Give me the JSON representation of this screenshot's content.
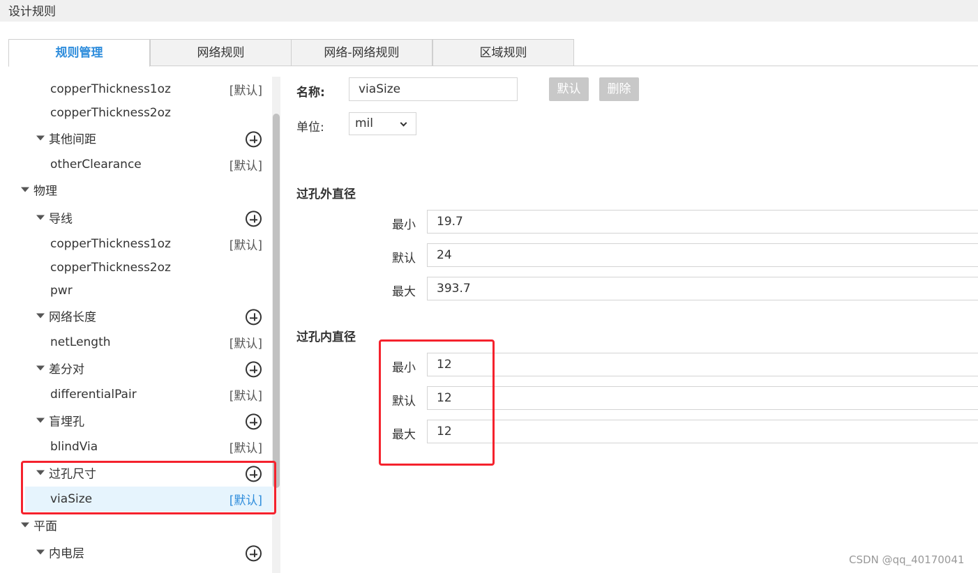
{
  "window": {
    "title": "设计规则"
  },
  "tabs": [
    {
      "label": "规则管理",
      "active": true
    },
    {
      "label": "网络规则",
      "active": false
    },
    {
      "label": "网络-网络规则",
      "active": false
    },
    {
      "label": "区域规则",
      "active": false
    }
  ],
  "tree": {
    "rows": [
      {
        "label": "copperThickness1oz",
        "tag": "[默认]"
      },
      {
        "label": "copperThickness2oz",
        "tag": ""
      },
      {
        "label": "其他间距",
        "tag": ""
      },
      {
        "label": "otherClearance",
        "tag": "[默认]"
      },
      {
        "label": "物理",
        "tag": ""
      },
      {
        "label": "导线",
        "tag": ""
      },
      {
        "label": "copperThickness1oz",
        "tag": "[默认]"
      },
      {
        "label": "copperThickness2oz",
        "tag": ""
      },
      {
        "label": "pwr",
        "tag": ""
      },
      {
        "label": "网络长度",
        "tag": ""
      },
      {
        "label": "netLength",
        "tag": "[默认]"
      },
      {
        "label": "差分对",
        "tag": ""
      },
      {
        "label": "differentialPair",
        "tag": "[默认]"
      },
      {
        "label": "盲埋孔",
        "tag": ""
      },
      {
        "label": "blindVia",
        "tag": "[默认]"
      },
      {
        "label": "过孔尺寸",
        "tag": ""
      },
      {
        "label": "viaSize",
        "tag": "[默认]"
      },
      {
        "label": "平面",
        "tag": ""
      },
      {
        "label": "内电层",
        "tag": ""
      }
    ]
  },
  "form": {
    "name_label": "名称:",
    "name_value": "viaSize",
    "default_button": "默认",
    "delete_button": "删除",
    "unit_label": "单位:",
    "unit_value": "mil",
    "outer": {
      "title": "过孔外直径",
      "min_label": "最小",
      "min_value": "19.7",
      "default_label": "默认",
      "default_value": "24",
      "max_label": "最大",
      "max_value": "393.7"
    },
    "inner": {
      "title": "过孔内直径",
      "min_label": "最小",
      "min_value": "12",
      "default_label": "默认",
      "default_value": "12",
      "max_label": "最大",
      "max_value": "12"
    }
  },
  "colors": {
    "accent": "#2f8ddc",
    "highlight": "#f5222d",
    "selected_row": "#e6f4fd"
  },
  "watermark": "CSDN @qq_40170041"
}
